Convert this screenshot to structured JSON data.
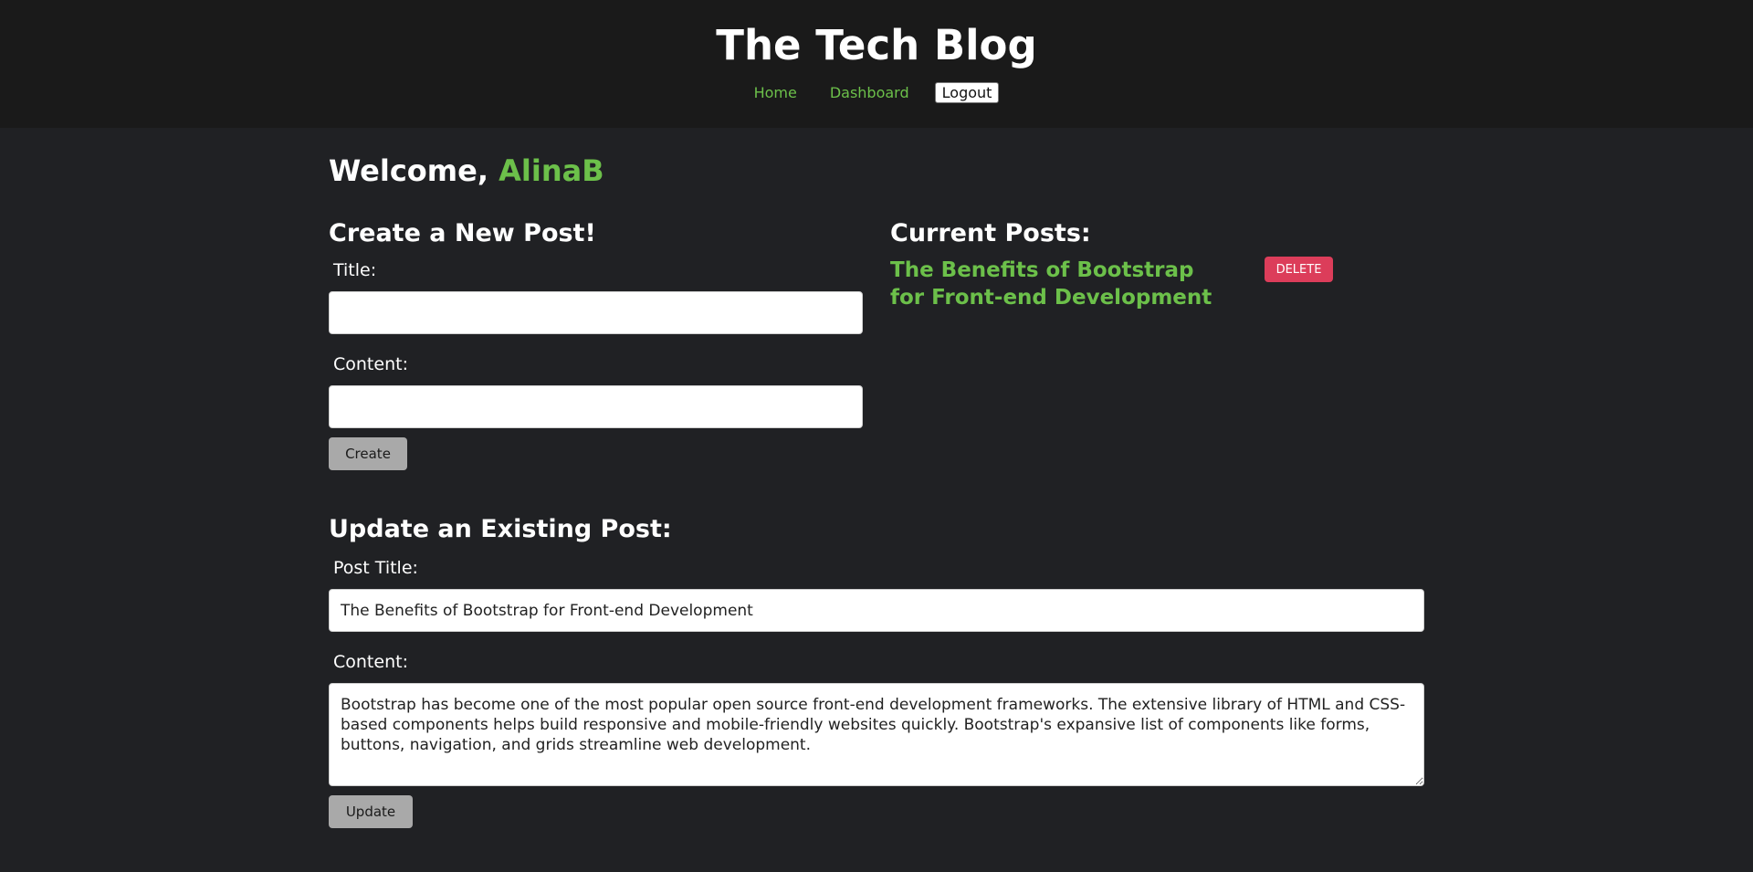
{
  "header": {
    "title": "The Tech Blog",
    "nav": {
      "home": "Home",
      "dashboard": "Dashboard",
      "logout": "Logout"
    }
  },
  "welcome": {
    "prefix": "Welcome,",
    "username": "AlinaB"
  },
  "create_post": {
    "heading": "Create a New Post!",
    "title_label": "Title:",
    "title_value": "",
    "content_label": "Content:",
    "content_value": "",
    "button": "Create"
  },
  "current_posts": {
    "heading": "Current Posts:",
    "posts": [
      {
        "title": "The Benefits of Bootstrap for Front-end Development",
        "delete_label": "DELETE"
      }
    ]
  },
  "update_post": {
    "heading": "Update an Existing Post:",
    "title_label": "Post Title:",
    "title_value": "The Benefits of Bootstrap for Front-end Development",
    "content_label": "Content:",
    "content_value": "Bootstrap has become one of the most popular open source front-end development frameworks. The extensive library of HTML and CSS-based components helps build responsive and mobile-friendly websites quickly. Bootstrap's expansive list of components like forms, buttons, navigation, and grids streamline web development.",
    "button": "Update"
  },
  "colors": {
    "accent": "#6cc04a",
    "delete": "#dc3d5a",
    "background": "#202124",
    "header_background": "#1a1a1a"
  }
}
